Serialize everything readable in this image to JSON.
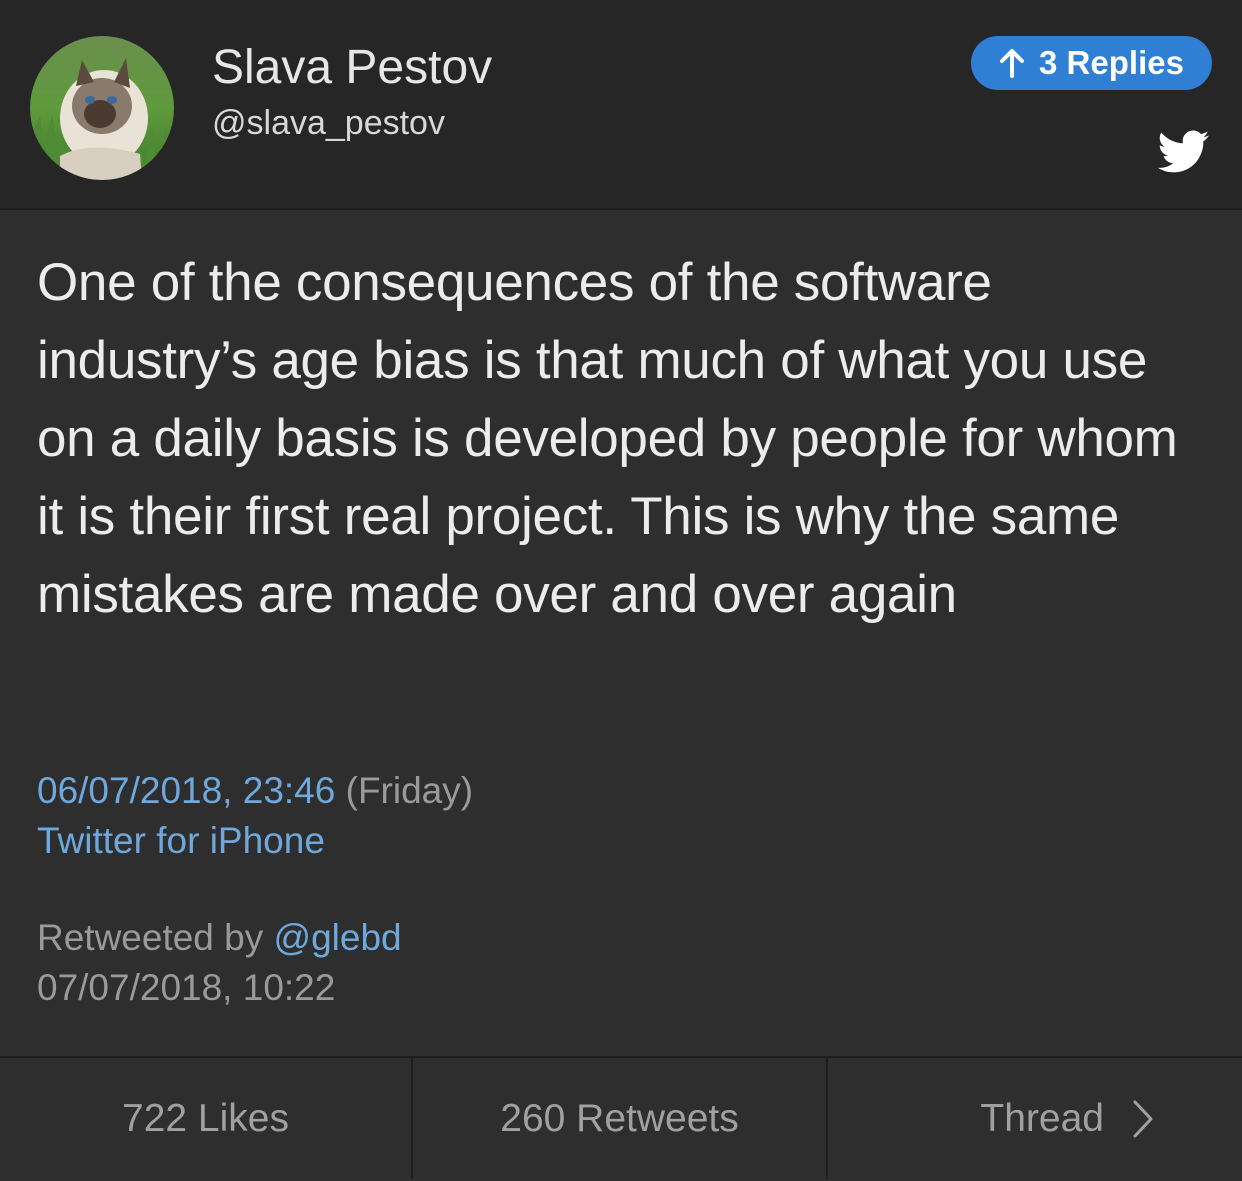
{
  "header": {
    "name": "Slava Pestov",
    "handle": "@slava_pestov",
    "replies_label": "3 Replies",
    "avatar_icon": "avatar-cat-photo",
    "brand_icon": "twitter-bird-icon",
    "accent_color": "#2f7fd4"
  },
  "tweet": {
    "text": "One of the consequences of the software industry’s age bias is that much of what you use on a daily basis is developed by people for whom it is their first real project. This is why the same mistakes are made over and over again",
    "datetime": "06/07/2018, 23:46",
    "weekday": "(Friday)",
    "source": "Twitter for iPhone",
    "link_color": "#6fa8dc"
  },
  "retweet": {
    "prefix": "Retweeted by",
    "user": "@glebd",
    "datetime": "07/07/2018, 10:22"
  },
  "footer": {
    "likes": "722 Likes",
    "retweets": "260 Retweets",
    "thread": "Thread"
  }
}
